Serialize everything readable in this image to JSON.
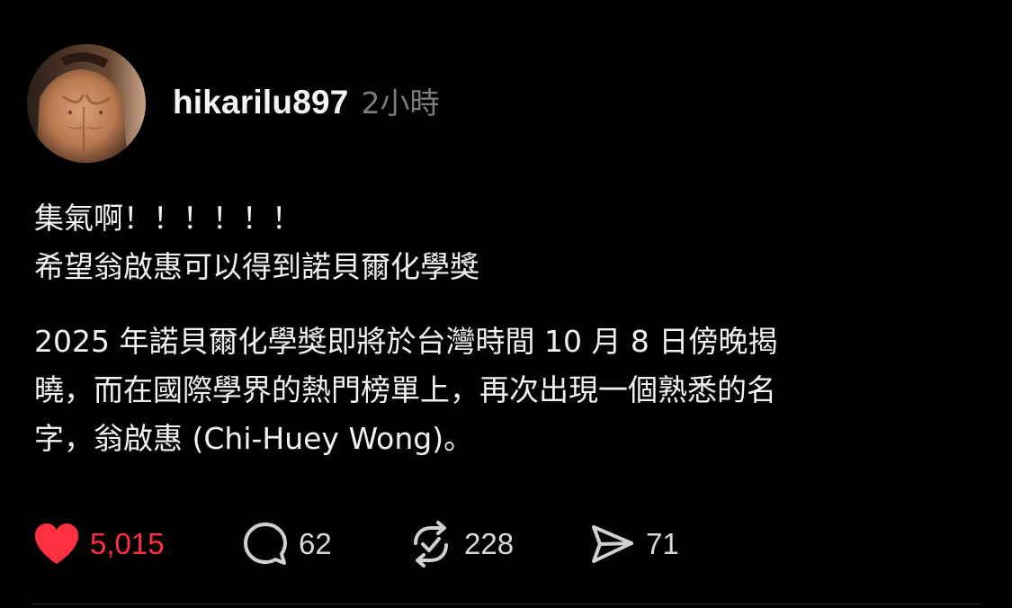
{
  "post": {
    "username": "hikarilu897",
    "timestamp": "2小時",
    "avatar_icon": "avatar-photo",
    "paragraphs": [
      [
        "集氣啊！！！！！！",
        "希望翁啟惠可以得到諾貝爾化學獎"
      ],
      [
        "2025 年諾貝爾化學獎即將於台灣時間 10 月 8 日傍晚揭",
        "曉，而在國際學界的熱門榜單上，再次出現一個熟悉的名",
        "字，翁啟惠 (Chi-Huey Wong)。"
      ]
    ]
  },
  "actions": {
    "like": {
      "icon": "heart-icon",
      "count": "5,015",
      "liked": true,
      "color": "#ff3040"
    },
    "reply": {
      "icon": "comment-bubble-icon",
      "count": "62"
    },
    "repost": {
      "icon": "repost-icon",
      "count": "228"
    },
    "share": {
      "icon": "send-icon",
      "count": "71"
    }
  }
}
